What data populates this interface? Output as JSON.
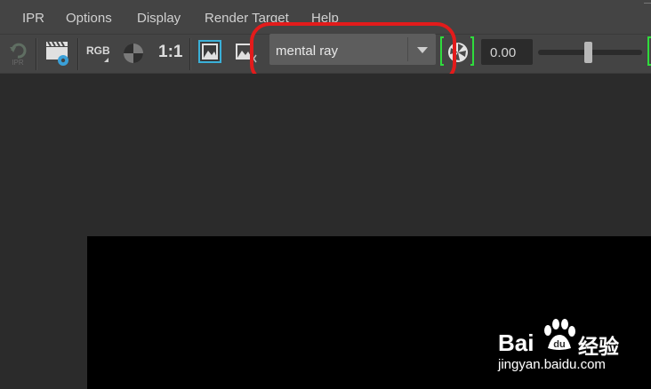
{
  "menu": {
    "items": [
      "IPR",
      "Options",
      "Display",
      "Render Target",
      "Help"
    ]
  },
  "toolbar": {
    "ipr_label": "IPR",
    "rgb_label": "RGB",
    "ratio_label": "1:1",
    "renderer_value": "mental ray",
    "exposure_value": "0.00",
    "exposure_slider_fraction": 0.48
  },
  "colors": {
    "highlight": "#e31b1b",
    "bracket": "#2fdc3c",
    "menubar": "#444444",
    "viewport": "#2b2b2b",
    "render_frame": "#000000"
  },
  "watermark": {
    "brand_left": "Bai",
    "brand_right": "经验",
    "url": "jingyan.baidu.com"
  }
}
